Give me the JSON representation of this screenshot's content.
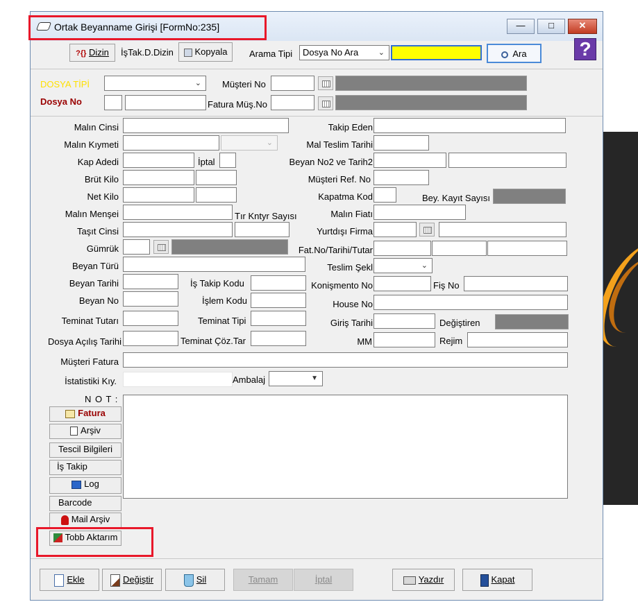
{
  "window": {
    "title": "Ortak Beyanname Girişi [FormNo:235]",
    "minimize": "—",
    "maximize": "□",
    "close": "✕"
  },
  "toolbar": {
    "dizin": "Dizin",
    "dizin_prefix": "?{}",
    "istak_dizin": "İşTak.D.Dizin",
    "kopyala": "Kopyala",
    "arama_tipi_label": "Arama Tipi",
    "arama_tipi_value": "Dosya No Ara",
    "search_value": "",
    "ara": "Ara",
    "help": "?"
  },
  "header": {
    "dosya_tipi": "DOSYA TİPİ",
    "dosya_no": "Dosya No",
    "musteri_no": "Müşteri No",
    "fatura_mus_no": "Fatura Müş.No"
  },
  "fields": {
    "malin_cinsi": "Malın Cinsi",
    "malin_kiymeti": "Malın Kıymeti",
    "kap_adedi": "Kap Adedi",
    "iptal": "İptal",
    "brut_kilo": "Brüt Kilo",
    "net_kilo": "Net Kilo",
    "malin_mensei": "Malın Menşei",
    "tir_kntyr": "Tır Kntyr Sayısı",
    "tasit_cinsi": "Taşıt Cinsi",
    "gumruk": "Gümrük",
    "beyan_turu": "Beyan Türü",
    "beyan_tarihi": "Beyan Tarihi",
    "is_takip_kodu": "İş Takip Kodu",
    "beyan_no": "Beyan No",
    "islem_kodu": "İşlem Kodu",
    "teminat_tutari": "Teminat Tutarı",
    "teminat_tipi": "Teminat Tipi",
    "dosya_acilis": "Dosya Açılış Tarihi",
    "teminat_coz": "Teminat Çöz.Tar",
    "musteri_fatura": "Müşteri Fatura",
    "istatistiki": "İstatistiki Kıy.",
    "ambalaj": "Ambalaj",
    "takip_eden": "Takip Eden",
    "mal_teslim": "Mal Teslim Tarihi",
    "beyan_no2": "Beyan  No2 ve Tarih2",
    "musteri_ref": "Müşteri  Ref. No",
    "kapatma_kod": "Kapatma Kod",
    "bey_kayit": "Bey. Kayıt Sayısı",
    "malin_fiati": "Malın Fiatı",
    "yurtdisi": "Yurtdışı Firma",
    "fat_no": "Fat.No/Tarihi/Tutar",
    "teslim_sekli": "Teslim Şekl",
    "konismento": "Konişmento No",
    "fis_no": "Fiş No",
    "house_no": "House No",
    "giris_tarihi": "Giriş Tarihi",
    "degistiren": "Değiştiren",
    "mm": "MM",
    "rejim": "Rejim",
    "not": "N O T :"
  },
  "side_buttons": {
    "fatura": "Fatura",
    "arsiv": "Arşiv",
    "tescil": "Tescil Bilgileri",
    "is_takip": "İş Takip",
    "log": "Log",
    "barcode": "Barcode",
    "mail_arsiv": "Mail Arşiv",
    "tobb": "Tobb Aktarım"
  },
  "footer": {
    "ekle": "Ekle",
    "degistir": "Değiştir",
    "sil": "Sil",
    "tamam": "Tamam",
    "iptal": "İptal",
    "yazdir": "Yazdır",
    "kapat": "Kapat"
  },
  "colors": {
    "accent_red": "#e8182a",
    "dosya_tipi": "#ffe000",
    "dosya_no": "#990000",
    "yellow_field": "#ffff00"
  }
}
